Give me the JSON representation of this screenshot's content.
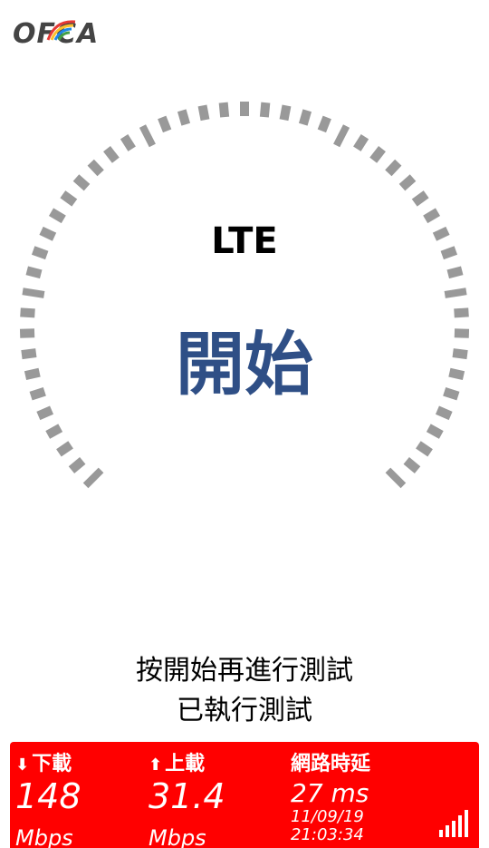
{
  "app": {
    "logo_text": "OFCA",
    "network_type": "LTE",
    "start_label": "開始"
  },
  "instructions": {
    "line1": "按開始再進行測試",
    "line2": "已執行測試"
  },
  "results": {
    "download": {
      "label": "下載",
      "arrow": "⬇",
      "value": "148",
      "unit": "Mbps"
    },
    "upload": {
      "label": "上載",
      "arrow": "⬆",
      "value": "31.4",
      "unit": "Mbps"
    },
    "latency": {
      "label": "網路時延",
      "value": "27 ms",
      "date": "11/09/19",
      "time": "21:03:34"
    }
  },
  "colors": {
    "accent": "#2f4f86",
    "panel": "#ff0000",
    "gauge": "#999999"
  },
  "icons": {
    "logo": "ofca-logo",
    "signal": "signal-strength-icon"
  }
}
